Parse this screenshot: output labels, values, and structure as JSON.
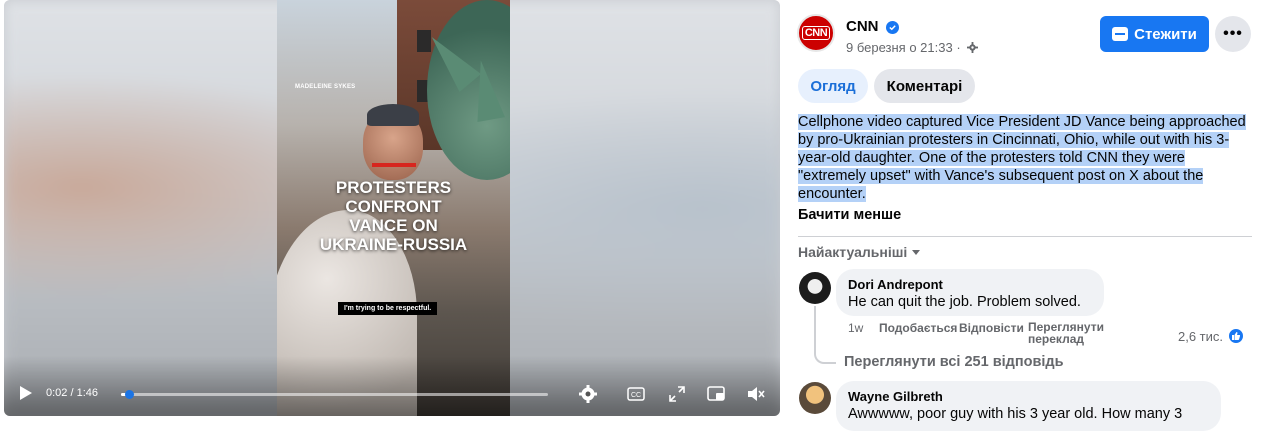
{
  "video": {
    "credit": "MADELEINE SYKES",
    "headline": "PROTESTERS\nCONFRONT\nVANCE ON\nUKRAINE-RUSSIA",
    "caption": "I'm trying to be respectful.",
    "time": "0:02 / 1:46",
    "progress_fraction": 0.019
  },
  "post": {
    "page_name": "CNN",
    "avatar_text": "CNN",
    "date": "9 березня о 21:33 ·",
    "follow_label": "Стежити",
    "more_label": "•••",
    "tabs": [
      "Огляд",
      "Коментарі"
    ],
    "description": "Cellphone video captured Vice President JD Vance being approached by pro-Ukrainian protesters in Cincinnati, Ohio, while out with his 3-year-old daughter. One of the protesters told CNN they were \"extremely upset\" with Vance's subsequent post on X about the encounter.",
    "see_less": "Бачити менше",
    "sort_label": "Найактуальніші"
  },
  "comments": [
    {
      "author": "Dori Andrepont",
      "text": "He can quit the job. Problem solved.",
      "time": "1w",
      "like": "Подобається",
      "reply": "Відповісти",
      "translate": "Переглянути\nпереклад",
      "likes_count": "2,6 тис.",
      "view_replies": "Переглянути всі 251 відповідь"
    },
    {
      "author": "Wayne Gilbreth",
      "text": "Awwwww, poor guy with his 3 year old. How many 3"
    }
  ],
  "colors": {
    "accent": "#1877f2",
    "cnn_red": "#cc0000",
    "highlight": "#b4d1f7"
  }
}
